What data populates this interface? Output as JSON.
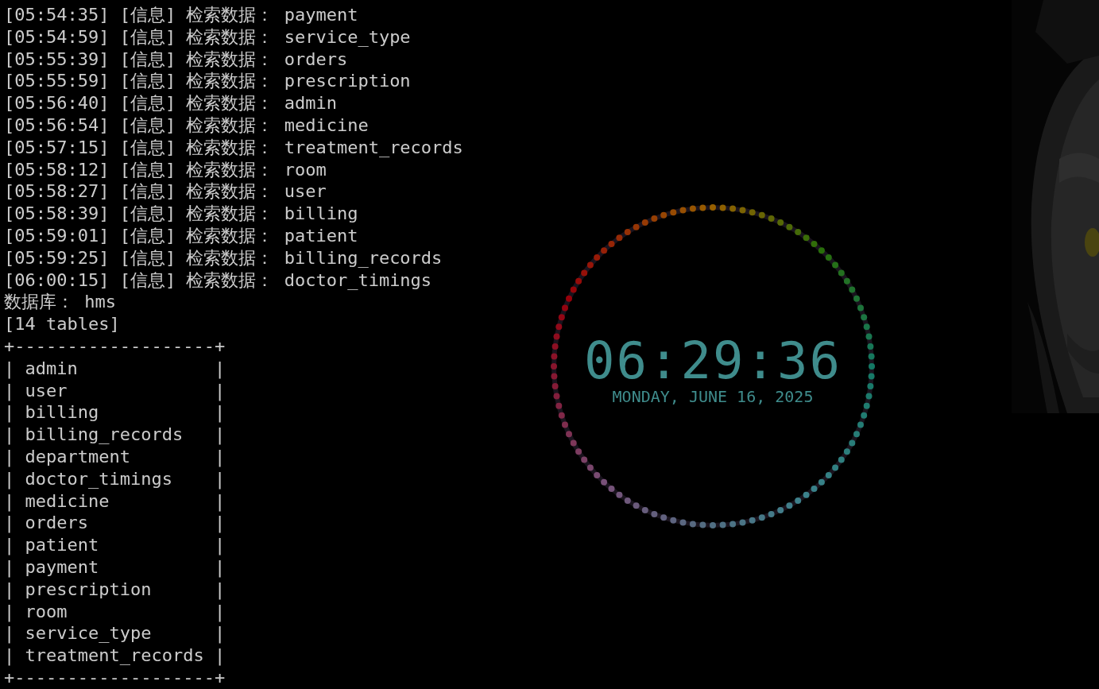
{
  "terminal": {
    "lines": [
      "[05:54:35] [信息] 检索数据： payment",
      "[05:54:59] [信息] 检索数据： service_type",
      "[05:55:39] [信息] 检索数据： orders",
      "[05:55:59] [信息] 检索数据： prescription",
      "[05:56:40] [信息] 检索数据： admin",
      "[05:56:54] [信息] 检索数据： medicine",
      "[05:57:15] [信息] 检索数据： treatment_records",
      "[05:58:12] [信息] 检索数据： room",
      "[05:58:27] [信息] 检索数据： user",
      "[05:58:39] [信息] 检索数据： billing",
      "[05:59:01] [信息] 检索数据： patient",
      "[05:59:25] [信息] 检索数据： billing_records",
      "[06:00:15] [信息] 检索数据： doctor_timings",
      "数据库： hms",
      "[14 tables]",
      "+-------------------+",
      "| admin             |",
      "| user              |",
      "| billing           |",
      "| billing_records   |",
      "| department        |",
      "| doctor_timings    |",
      "| medicine          |",
      "| orders            |",
      "| patient           |",
      "| payment           |",
      "| prescription      |",
      "| room              |",
      "| service_type      |",
      "| treatment_records |",
      "+-------------------+"
    ]
  },
  "clock_widget": {
    "time": "06:29:36",
    "date": "MONDAY, JUNE 16, 2025"
  }
}
